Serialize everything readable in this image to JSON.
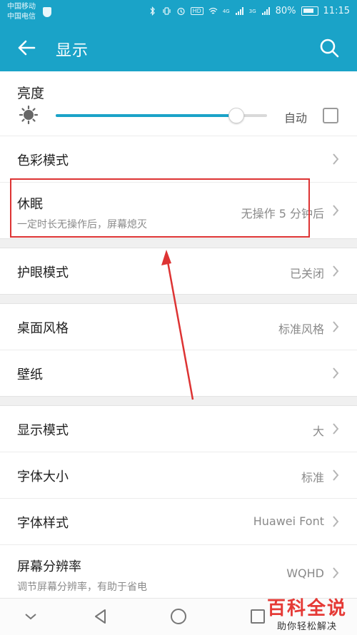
{
  "status_bar": {
    "carrier_1": "中国移动",
    "carrier_2": "中国电信",
    "net_1": "4G",
    "net_2": "3G",
    "hd": "HD",
    "battery_percent": "80%",
    "time": "11:15"
  },
  "header": {
    "title": "显示"
  },
  "brightness": {
    "title": "亮度",
    "auto_label": "自动",
    "level": 0.85,
    "auto_checked": false
  },
  "rows_a": [
    {
      "label": "色彩模式",
      "value": ""
    },
    {
      "label": "休眠",
      "sublabel": "一定时长无操作后，屏幕熄灭",
      "value": "无操作 5 分钟后"
    }
  ],
  "rows_b": [
    {
      "label": "护眼模式",
      "value": "已关闭"
    }
  ],
  "rows_c": [
    {
      "label": "桌面风格",
      "value": "标准风格"
    },
    {
      "label": "壁纸",
      "value": ""
    }
  ],
  "rows_d": [
    {
      "label": "显示模式",
      "value": "大"
    },
    {
      "label": "字体大小",
      "value": "标准"
    },
    {
      "label": "字体样式",
      "value": "Huawei Font"
    },
    {
      "label": "屏幕分辨率",
      "sublabel": "调节屏幕分辨率，有助于省电",
      "value": "WQHD"
    }
  ],
  "watermark": {
    "title": "百科全说",
    "subtitle": "助你轻松解决"
  },
  "colors": {
    "accent": "#1aa3c8",
    "annotation": "#dd3333"
  }
}
